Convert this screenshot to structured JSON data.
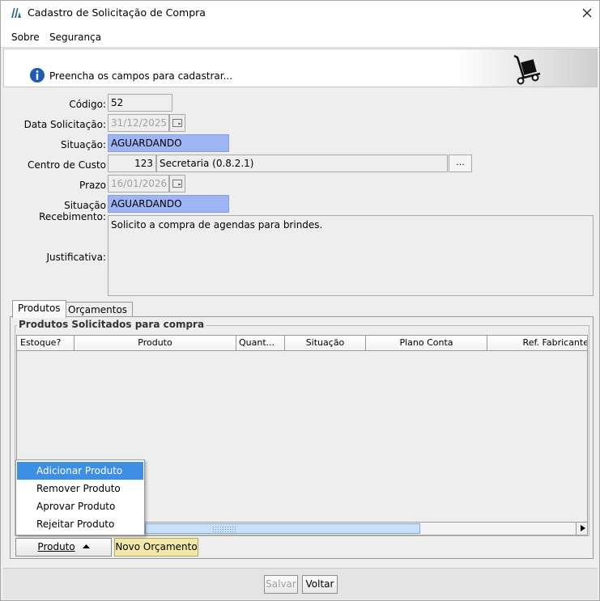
{
  "window": {
    "title": "Cadastro de Solicitação de Compra"
  },
  "menu": {
    "items": [
      "Sobre",
      "Segurança"
    ]
  },
  "banner": {
    "message": "Preencha os campos para cadastrar..."
  },
  "form": {
    "codigo": {
      "label": "Código:",
      "value": "52"
    },
    "data_solicitacao": {
      "label": "Data Solicitação:",
      "value": "31/12/2025"
    },
    "situacao": {
      "label": "Situação:",
      "value": "AGUARDANDO"
    },
    "centro_custo": {
      "label": "Centro de Custo",
      "code": "123",
      "name": "Secretaria (0.8.2.1)",
      "lookup_label": "..."
    },
    "prazo": {
      "label": "Prazo",
      "value": "16/01/2026"
    },
    "situacao_recebimento": {
      "label": "Situação Recebimento:",
      "value": "AGUARDANDO"
    },
    "justificativa": {
      "label": "Justificativa:",
      "value": "Solicito a compra de agendas para brindes."
    }
  },
  "tabs": [
    {
      "label": "Produtos",
      "active": true
    },
    {
      "label": "Orçamentos",
      "active": false
    }
  ],
  "products_group": {
    "title": "Produtos Solicitados para compra",
    "columns": [
      "Estoque?",
      "Produto",
      "Quant...",
      "Situação",
      "Plano Conta",
      "Ref. Fabricante"
    ],
    "rows": []
  },
  "product_menu": {
    "items": [
      "Adicionar Produto",
      "Remover Produto",
      "Aprovar Produto",
      "Rejeitar Produto"
    ],
    "selected": "Adicionar Produto"
  },
  "buttons": {
    "produto": "Produto",
    "novo_orcamento": "Novo Orçamento",
    "salvar": "Salvar",
    "voltar": "Voltar"
  },
  "colors": {
    "status_blue": "#9db4f5",
    "menu_highlight": "#3d8fe6",
    "novo_orcamento_bg": "#f3e7a8"
  }
}
